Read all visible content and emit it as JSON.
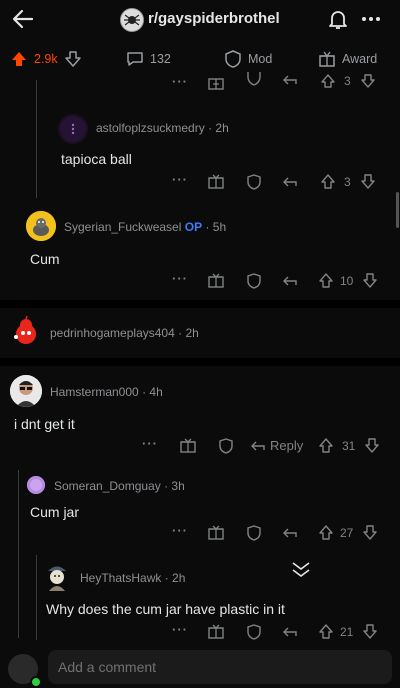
{
  "header": {
    "subreddit": "r/gayspiderbrothel"
  },
  "post_actions": {
    "score": "2.9k",
    "comments": "132",
    "mod_label": "Mod",
    "award_label": "Award"
  },
  "comments": [
    {
      "id": "c0",
      "vote_count": "3"
    },
    {
      "id": "c1",
      "user": "astolfoplzsuckmedry",
      "time": "· 2h",
      "text": "tapioca ball",
      "vote_count": "3"
    },
    {
      "id": "c2",
      "user": "Sygerian_Fuckweasel",
      "badge": "OP",
      "time": "· 5h",
      "text": "Cum",
      "vote_count": "10"
    },
    {
      "id": "c3",
      "user": "pedrinhogameplays404",
      "time": "· 2h"
    },
    {
      "id": "c4",
      "user": "Hamsterman000",
      "time": "· 4h",
      "text": "i dnt get it",
      "reply_label": "Reply",
      "vote_count": "31"
    },
    {
      "id": "c5",
      "user": "Someran_Domguay",
      "time": "· 3h",
      "text": "Cum jar",
      "vote_count": "27"
    },
    {
      "id": "c6",
      "user": "HeyThatsHawk",
      "time": "· 2h",
      "text": "Why does the cum jar have plastic in it",
      "vote_count": "21"
    }
  ],
  "composer": {
    "placeholder": "Add a comment"
  },
  "colors": {
    "upvote": "#ff4500",
    "op_badge": "#3d7bf7",
    "background": "#0b0b0b"
  }
}
